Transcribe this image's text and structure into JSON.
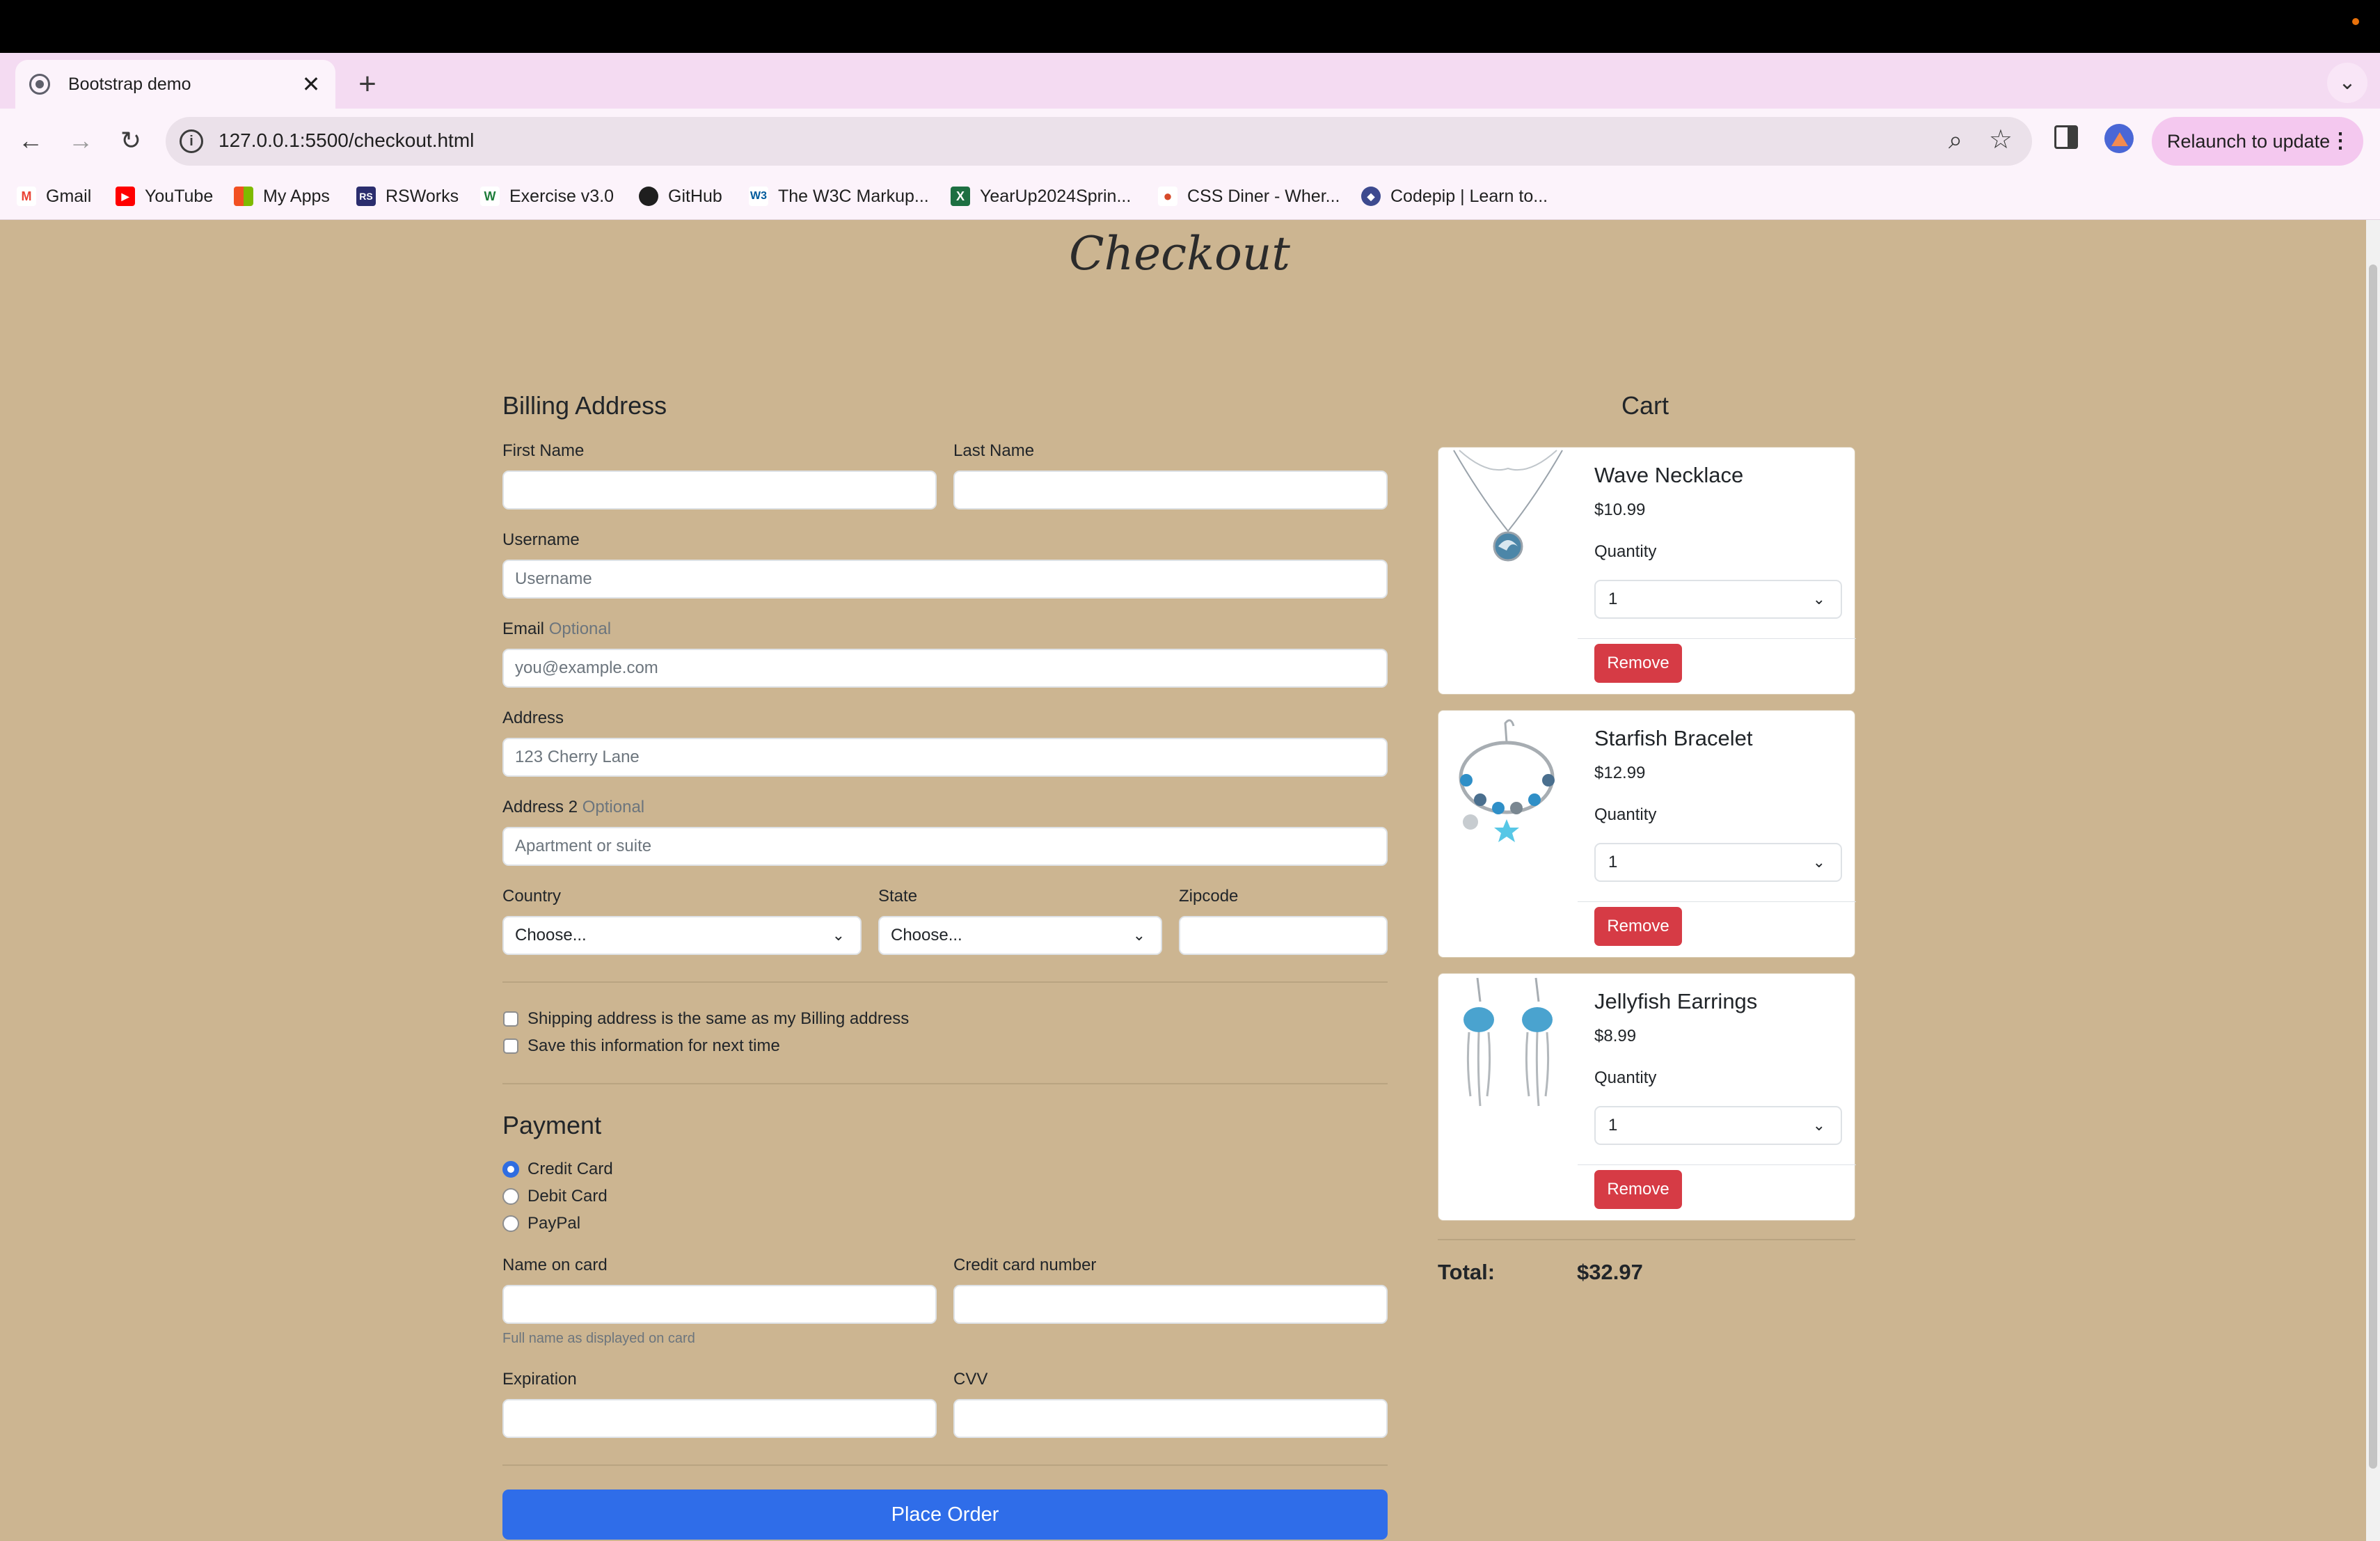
{
  "browser": {
    "tab_title": "Bootstrap demo",
    "tab_close": "✕",
    "new_tab": "+",
    "tab_menu": "⌄",
    "back": "←",
    "forward": "→",
    "reload": "↻",
    "url": "127.0.0.1:5500/checkout.html",
    "info_icon": "i",
    "relaunch_label": "Relaunch to update",
    "menu_dots": "⋮"
  },
  "bookmarks": [
    {
      "label": "Gmail",
      "icon": "gmail-icon",
      "glyph": "M",
      "color": "#ea4335"
    },
    {
      "label": "YouTube",
      "icon": "youtube-icon",
      "glyph": "▶",
      "color": "#ff0000"
    },
    {
      "label": "My Apps",
      "icon": "apps-grid-icon",
      "glyph": "▦",
      "color": "#f25022"
    },
    {
      "label": "RSWorks",
      "icon": "rsworks-icon",
      "glyph": "RS",
      "color": "#2b2d6e"
    },
    {
      "label": "Exercise v3.0",
      "icon": "w-logo-icon",
      "glyph": "W",
      "color": "#1e7d3a"
    },
    {
      "label": "GitHub",
      "icon": "github-icon",
      "glyph": "●",
      "color": "#1f1f1f"
    },
    {
      "label": "The W3C Markup...",
      "icon": "w3c-icon",
      "glyph": "W3",
      "color": "#005a9c"
    },
    {
      "label": "YearUp2024Sprin...",
      "icon": "excel-icon",
      "glyph": "X",
      "color": "#1d6f42"
    },
    {
      "label": "CSS Diner - Wher...",
      "icon": "css-diner-icon",
      "glyph": "●",
      "color": "#d64a2a"
    },
    {
      "label": "Codepip | Learn to...",
      "icon": "codepip-icon",
      "glyph": "◆",
      "color": "#3d4a8f"
    }
  ],
  "page": {
    "title": "Checkout",
    "billing": {
      "heading": "Billing Address",
      "first_name_label": "First Name",
      "last_name_label": "Last Name",
      "username_label": "Username",
      "username_placeholder": "Username",
      "email_label": "Email",
      "email_optional": "Optional",
      "email_placeholder": "you@example.com",
      "address_label": "Address",
      "address_placeholder": "123 Cherry Lane",
      "address2_label": "Address 2",
      "address2_optional": "Optional",
      "address2_placeholder": "Apartment or suite",
      "country_label": "Country",
      "country_value": "Choose...",
      "state_label": "State",
      "state_value": "Choose...",
      "zip_label": "Zipcode",
      "same_address_label": "Shipping address is the same as my Billing address",
      "save_info_label": "Save this information for next time"
    },
    "payment": {
      "heading": "Payment",
      "methods": [
        "Credit Card",
        "Debit Card",
        "PayPal"
      ],
      "selected": "Credit Card",
      "name_on_card_label": "Name on card",
      "name_on_card_help": "Full name as displayed on card",
      "cc_number_label": "Credit card number",
      "expiration_label": "Expiration",
      "cvv_label": "CVV",
      "place_order": "Place Order"
    },
    "cart": {
      "heading": "Cart",
      "quantity_label": "Quantity",
      "remove_label": "Remove",
      "items": [
        {
          "name": "Wave Necklace",
          "price": "$10.99",
          "quantity": "1"
        },
        {
          "name": "Starfish Bracelet",
          "price": "$12.99",
          "quantity": "1"
        },
        {
          "name": "Jellyfish Earrings",
          "price": "$8.99",
          "quantity": "1"
        }
      ],
      "total_label": "Total:",
      "total_value": "$32.97"
    }
  },
  "colors": {
    "page_bg": "#ccb591",
    "primary": "#2f6de9",
    "danger": "#d63b45"
  }
}
